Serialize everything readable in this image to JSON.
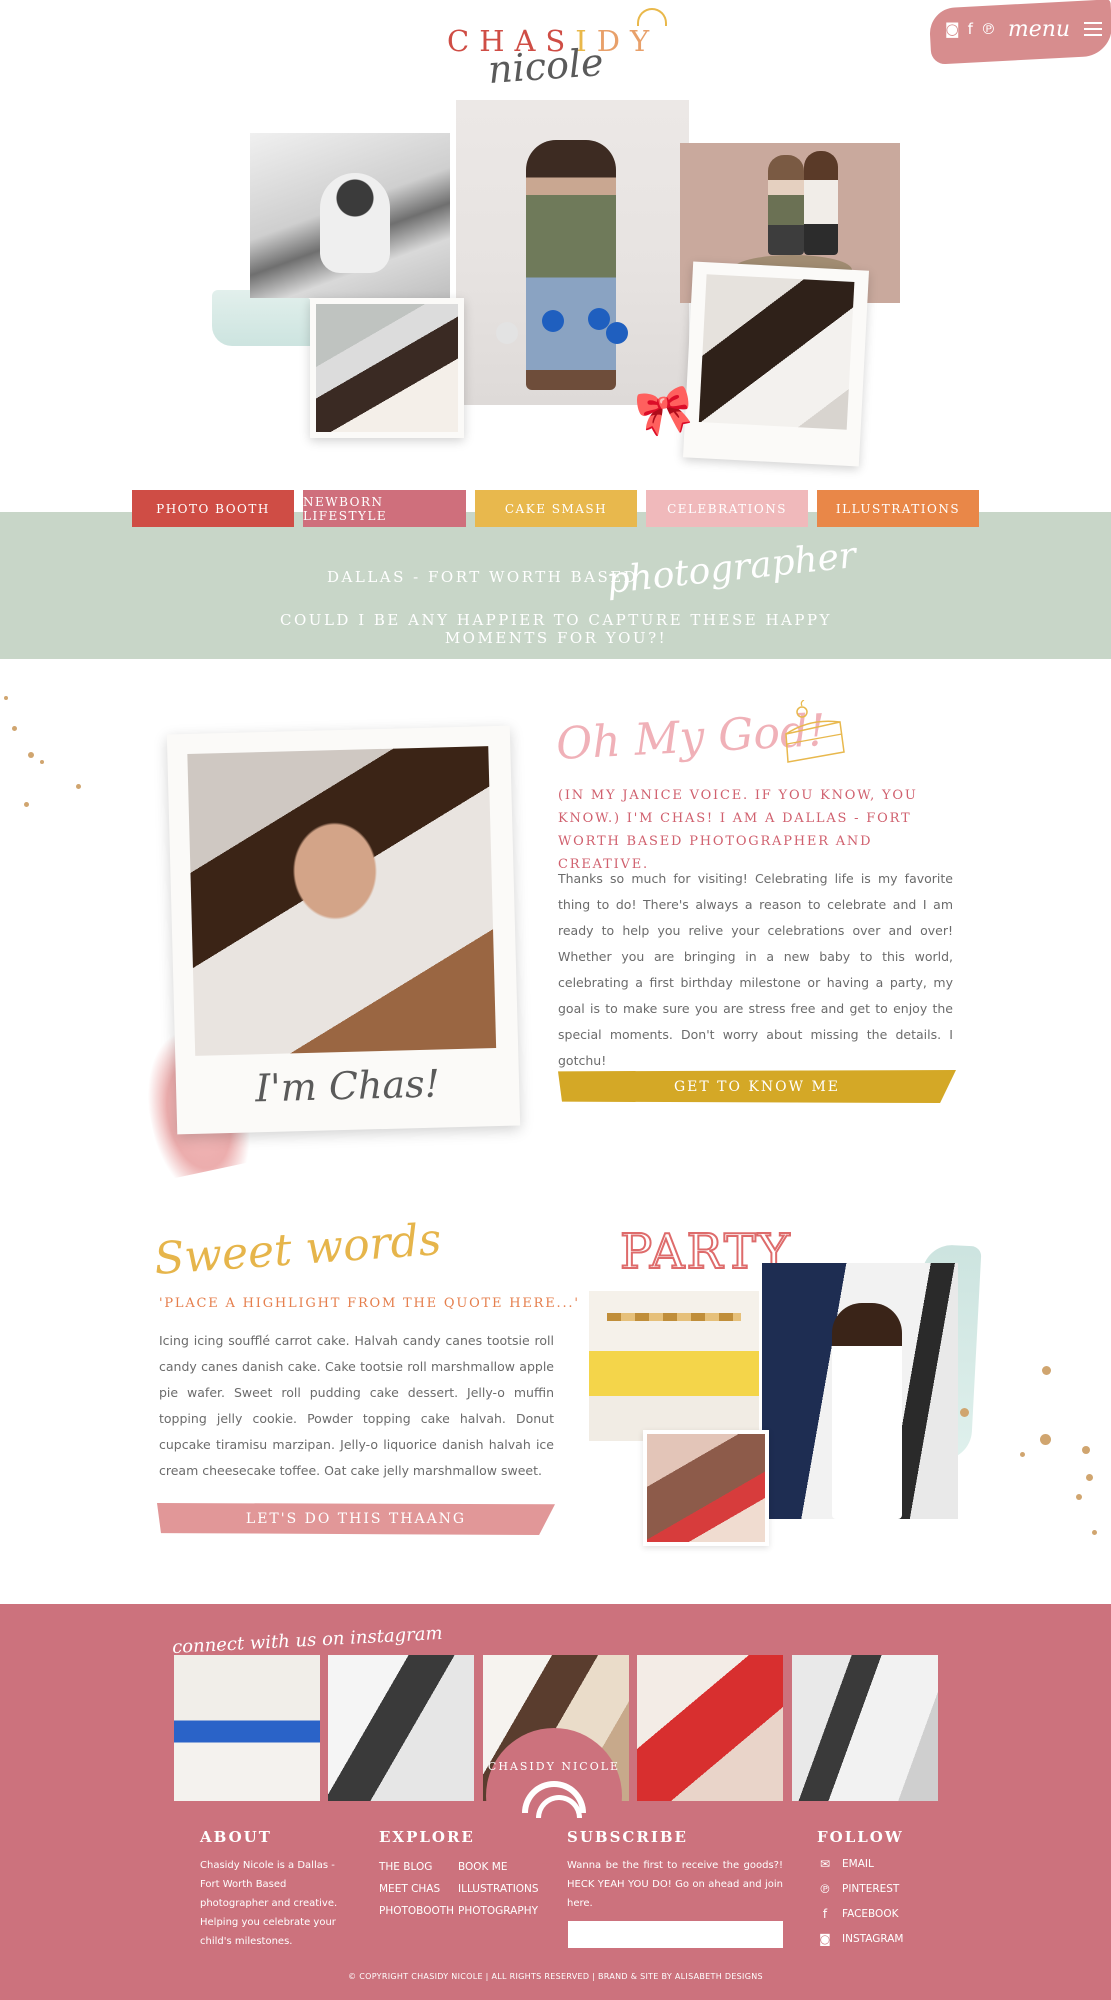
{
  "brand": {
    "logo_top": "CHASIDY",
    "logo_script": "nicole"
  },
  "menu": {
    "label": "menu",
    "icons": [
      "instagram-icon",
      "facebook-icon",
      "pinterest-icon"
    ]
  },
  "categories": [
    {
      "label": "PHOTO BOOTH",
      "color": "#cf4d45"
    },
    {
      "label": "NEWBORN LIFESTYLE",
      "color": "#cf6f7c"
    },
    {
      "label": "CAKE SMASH",
      "color": "#e8b84d"
    },
    {
      "label": "CELEBRATIONS",
      "color": "#f0b9bb"
    },
    {
      "label": "ILLUSTRATIONS",
      "color": "#e98748"
    }
  ],
  "banner": {
    "line1": "DALLAS - FORT WORTH BASED",
    "script": "photographer",
    "line2": "COULD I BE ANY HAPPIER TO CAPTURE THESE HAPPY MOMENTS FOR YOU?!"
  },
  "about": {
    "photo_caption": "I'm Chas!",
    "heading": "Oh My God!",
    "subheading": "(IN MY JANICE VOICE. IF YOU KNOW, YOU KNOW.) I'M CHAS! I AM A DALLAS - FORT WORTH BASED PHOTOGRAPHER AND CREATIVE.",
    "body": "Thanks so much for visiting! Celebrating life is my favorite thing to do! There's always a reason to celebrate and I am ready to help you relive your celebrations over and over! Whether you are bringing in a new baby to this world, celebrating a first birthday milestone or having a party, my goal is to make sure you are stress free and get to enjoy the special moments. Don't worry about missing the details. I gotchu!",
    "button": "GET TO KNOW ME"
  },
  "sweet_words": {
    "heading": "Sweet words",
    "quote": "'PLACE A HIGHLIGHT FROM THE QUOTE HERE...'",
    "body": "Icing icing soufflé carrot cake. Halvah candy canes tootsie roll candy canes danish cake. Cake tootsie roll marshmallow apple pie wafer. Sweet roll pudding cake dessert. Jelly-o muffin topping jelly cookie. Powder topping cake halvah. Donut cupcake tiramisu marzipan. Jelly-o liquorice danish halvah ice cream cheesecake toffee. Oat cake jelly marshmallow sweet.",
    "button": "LET'S DO THIS THAANG",
    "party_title": "PARTY"
  },
  "footer": {
    "instagram_title": "connect with us on instagram",
    "badge_text": "CHASIDY NICOLE",
    "about": {
      "heading": "ABOUT",
      "text": "Chasidy Nicole is a Dallas - Fort Worth Based photographer and creative. Helping you celebrate your child's milestones."
    },
    "explore": {
      "heading": "EXPLORE",
      "col1": [
        "THE BLOG",
        "MEET CHAS",
        "PHOTOBOOTH"
      ],
      "col2": [
        "BOOK ME",
        "ILLUSTRATIONS",
        "PHOTOGRAPHY"
      ]
    },
    "subscribe": {
      "heading": "SUBSCRIBE",
      "text": "Wanna be the first to receive the goods?! HECK YEAH YOU DO! Go on ahead and join here.",
      "placeholder": ""
    },
    "follow": {
      "heading": "FOLLOW",
      "items": [
        {
          "label": "EMAIL",
          "icon": "envelope-icon"
        },
        {
          "label": "PINTEREST",
          "icon": "pinterest-icon"
        },
        {
          "label": "FACEBOOK",
          "icon": "facebook-icon"
        },
        {
          "label": "INSTAGRAM",
          "icon": "instagram-icon"
        }
      ]
    },
    "copyright": "© COPYRIGHT CHASIDY NICOLE | ALL RIGHTS RESERVED | BRAND & SITE BY ALISABETH DESIGNS"
  }
}
